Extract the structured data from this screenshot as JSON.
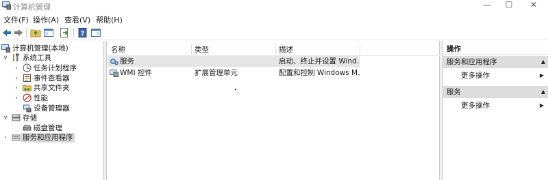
{
  "window": {
    "title": "计算机管理",
    "min_glyph": "—",
    "max_glyph": "☐",
    "close_glyph": "✕"
  },
  "menu": {
    "file": "文件(F)",
    "action": "操作(A)",
    "view": "查看(V)",
    "help": "帮助(H)"
  },
  "tree": {
    "root": "计算机管理(本地)",
    "system_tools": "系统工具",
    "task_scheduler": "任务计划程序",
    "event_viewer": "事件查看器",
    "shared_folders": "共享文件夹",
    "performance": "性能",
    "device_manager": "设备管理器",
    "storage": "存储",
    "disk_management": "磁盘管理",
    "services_apps": "服务和应用程序",
    "expanded_glyph": "∨",
    "collapsed_glyph": "›"
  },
  "list": {
    "columns": {
      "name": "名称",
      "type": "类型",
      "description": "描述"
    },
    "rows": [
      {
        "name": "服务",
        "type": "",
        "description": "启动、终止并设置 Wind..."
      },
      {
        "name": "WMI 控件",
        "type": "扩展管理单元",
        "description": "配置和控制 Windows M..."
      }
    ]
  },
  "actions": {
    "title": "操作",
    "section1": "服务和应用程序",
    "section1_item": "更多操作",
    "section2": "服务",
    "section2_item": "更多操作",
    "collapse_glyph": "▲",
    "submenu_glyph": "▶"
  },
  "colors": {
    "selection": "#e5e5e5",
    "section_bg": "#dcdcdc",
    "toolbar_arrow": "#2a6fb5"
  }
}
